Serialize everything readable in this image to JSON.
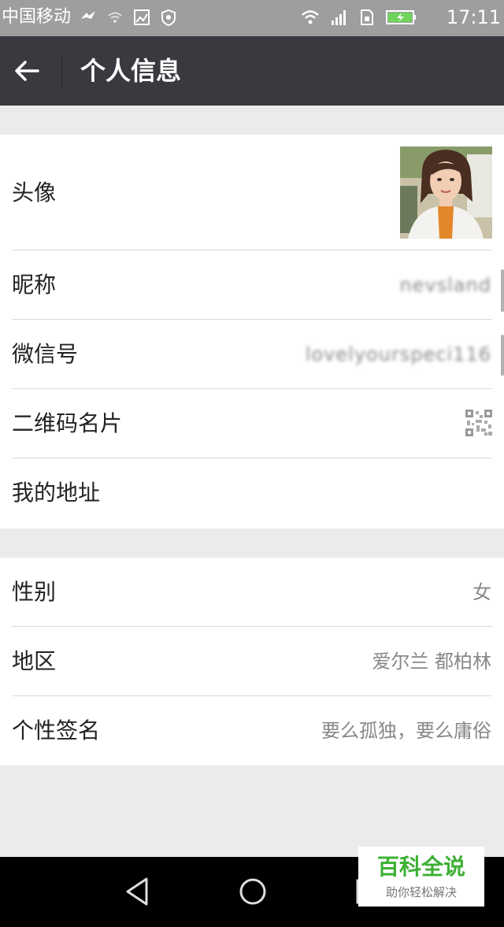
{
  "status_bar": {
    "carrier": "中国移动",
    "time": "17:11",
    "icons": [
      "bird-icon",
      "wifi-weak-icon",
      "image-icon",
      "shield-icon",
      "wifi-icon",
      "signal-icon",
      "sim-icon",
      "battery-charging-icon"
    ]
  },
  "toolbar": {
    "back_icon": "arrow-left-icon",
    "title": "个人信息"
  },
  "profile": {
    "avatar_label": "头像",
    "nickname_label": "昵称",
    "nickname_value": "nevsland",
    "wechat_id_label": "微信号",
    "wechat_id_value": "lovelyourspeci116",
    "qr_label": "二维码名片",
    "qr_icon": "qrcode-icon",
    "address_label": "我的地址"
  },
  "details": {
    "gender_label": "性别",
    "gender_value": "女",
    "region_label": "地区",
    "region_value": "爱尔兰 都柏林",
    "signature_label": "个性签名",
    "signature_value": "要么孤独，要么庸俗"
  },
  "navbar": {
    "icons": [
      "back-triangle-icon",
      "home-circle-icon",
      "recents-square-icon"
    ]
  },
  "watermark": {
    "brand": "百科全说",
    "tagline": "助你轻松解决"
  },
  "colors": {
    "toolbar": "#393a3f",
    "background": "#ebebeb",
    "watermark_green": "#3cb034"
  }
}
